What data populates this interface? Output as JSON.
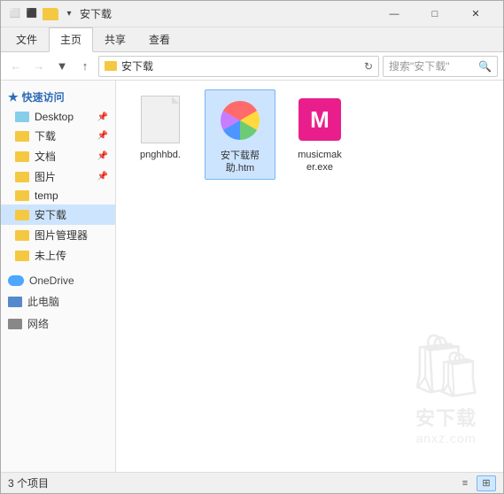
{
  "window": {
    "title": "安下载",
    "controls": {
      "minimize": "—",
      "maximize": "□",
      "close": "✕"
    }
  },
  "ribbon": {
    "tabs": [
      {
        "label": "文件",
        "active": false
      },
      {
        "label": "主页",
        "active": true
      },
      {
        "label": "共享",
        "active": false
      },
      {
        "label": "查看",
        "active": false
      }
    ]
  },
  "toolbar": {
    "back_tooltip": "后退",
    "forward_tooltip": "前进",
    "up_tooltip": "向上",
    "address": "安下载",
    "search_placeholder": "搜索\"安下载\""
  },
  "sidebar": {
    "quick_access_label": "快速访问",
    "items": [
      {
        "label": "Desktop",
        "type": "desktop",
        "pinned": true
      },
      {
        "label": "下载",
        "type": "folder",
        "pinned": true
      },
      {
        "label": "文档",
        "type": "folder",
        "pinned": true
      },
      {
        "label": "图片",
        "type": "folder",
        "pinned": true
      },
      {
        "label": "temp",
        "type": "folder",
        "pinned": false
      },
      {
        "label": "安下载",
        "type": "folder",
        "pinned": false,
        "active": true
      },
      {
        "label": "图片管理器",
        "type": "folder",
        "pinned": false
      },
      {
        "label": "未上传",
        "type": "folder",
        "pinned": false
      }
    ],
    "onedrive_label": "OneDrive",
    "pc_label": "此电脑",
    "network_label": "网络"
  },
  "files": [
    {
      "name": "pnghhbd.",
      "type": "doc"
    },
    {
      "name": "安下载帮助.htm",
      "type": "htm"
    },
    {
      "name": "musicmak er.exe",
      "type": "exe"
    }
  ],
  "status": {
    "count_label": "3 个项目"
  },
  "watermark": {
    "text": "安下载",
    "url": "anxz.com"
  }
}
